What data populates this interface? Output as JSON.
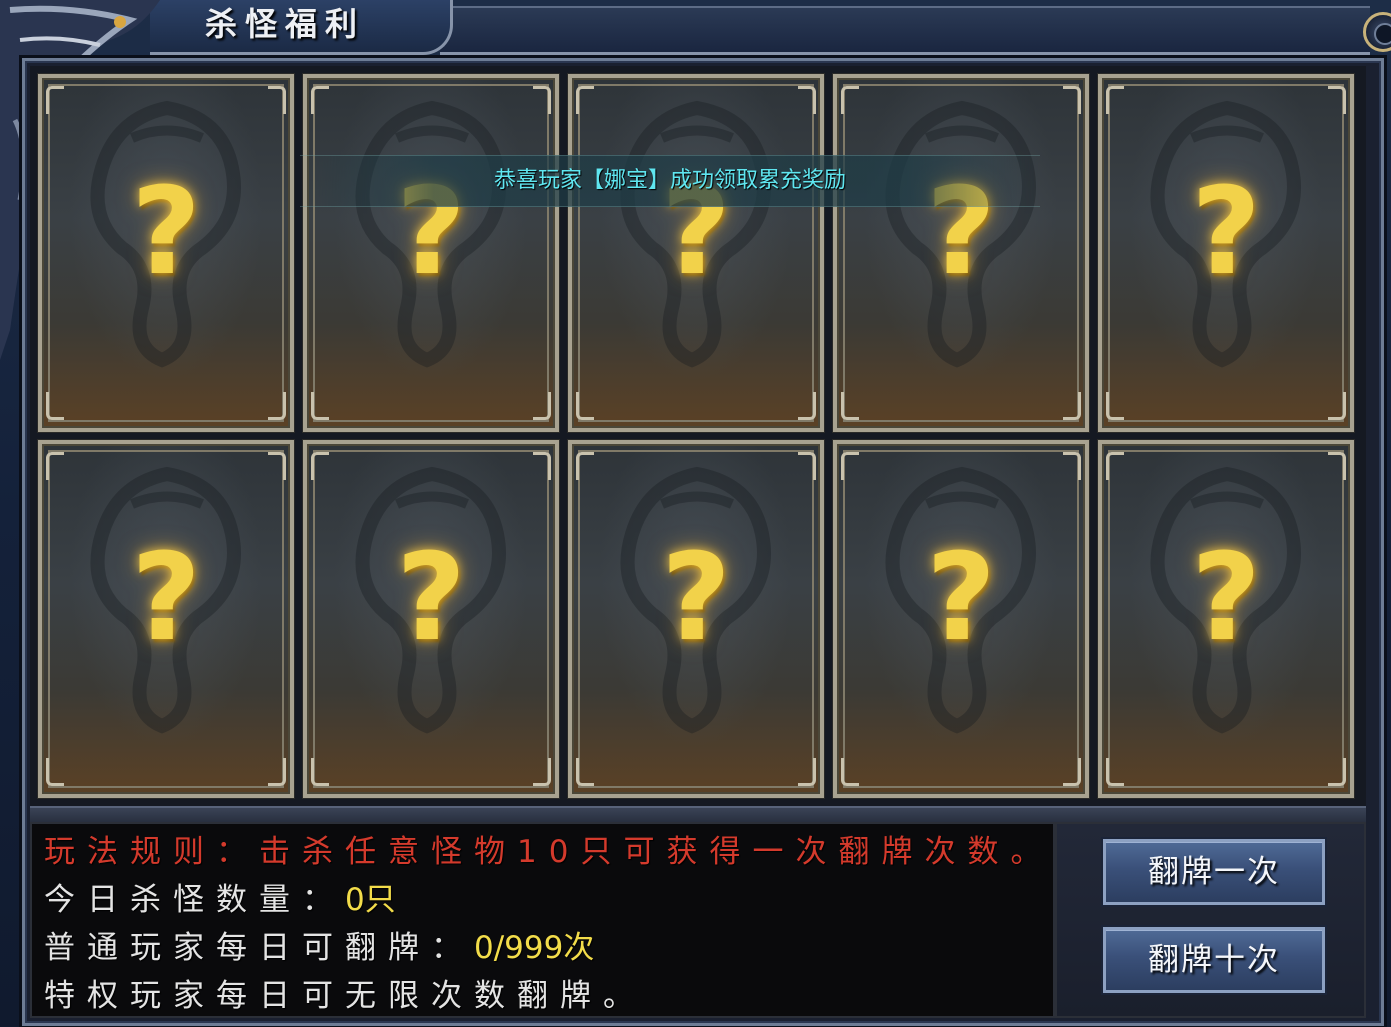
{
  "window": {
    "title": "杀怪福利"
  },
  "notice": {
    "text": "恭喜玩家【娜宝】成功领取累充奖励"
  },
  "cards": [
    {
      "symbol": "?"
    },
    {
      "symbol": "?"
    },
    {
      "symbol": "?"
    },
    {
      "symbol": "?"
    },
    {
      "symbol": "?"
    },
    {
      "symbol": "?"
    },
    {
      "symbol": "?"
    },
    {
      "symbol": "?"
    },
    {
      "symbol": "?"
    },
    {
      "symbol": "?"
    }
  ],
  "info": {
    "rule": "玩法规则：击杀任意怪物10只可获得一次翻牌次数。",
    "kill_label": "今日杀怪数量：",
    "kill_value": "0只",
    "normal_label": "普通玩家每日可翻牌：",
    "normal_value": "0/999次",
    "vip_text": "特权玩家每日可无限次数翻牌。"
  },
  "buttons": {
    "flip_once": "翻牌一次",
    "flip_ten": "翻牌十次"
  },
  "colors": {
    "rule_red": "#d43a2c",
    "value_yellow": "#f2dc4a",
    "notice_cyan": "#5fe6f0",
    "question_gold": "#f2d24a"
  },
  "icons": {
    "card_back": "dragon-emblem-icon",
    "card_symbol": "question-mark-icon",
    "close": "close-icon"
  }
}
